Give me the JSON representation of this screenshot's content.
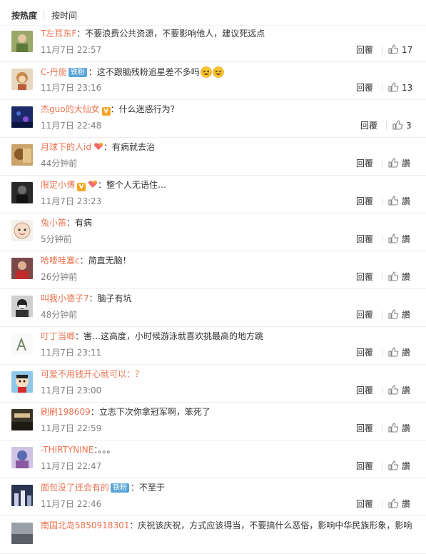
{
  "sort": {
    "hot": "按热度",
    "time": "按时间"
  },
  "reply_label": "回覆",
  "like_label": "讚",
  "colors": {
    "username": "#eb7350",
    "fans_badge": "#5aa5d8",
    "vip_badge": "#f5a623"
  },
  "comments": [
    {
      "user": "T左耳东F",
      "text": "不要浪费公共资源，不要影响他人，建议死远点",
      "time": "11月7日 22:57",
      "likes": "17",
      "avatar": "person-green"
    },
    {
      "user": "C-丹旎",
      "fans_badge": "铁粉",
      "text": "这不跟脑残粉追星差不多吗",
      "emoji": "laughing-emoji",
      "time": "11月7日 23:16",
      "likes": "13",
      "avatar": "doll"
    },
    {
      "user": "杰guo的大仙女",
      "vip": "V",
      "text": "什么迷惑行为？",
      "time": "11月7日 22:48",
      "likes": "3",
      "avatar": "night-blue"
    },
    {
      "user": "月球下的人id",
      "heart": true,
      "text": "有病就去治",
      "time": "44分钟前",
      "likes": "",
      "avatar": "warm-brown"
    },
    {
      "user": "限定小博",
      "vip": "V",
      "heart": true,
      "text": "整个人无语住…",
      "time": "11月7日 23:23",
      "likes": "",
      "avatar": "dark-figure"
    },
    {
      "user": "兔小笛",
      "text": "有病",
      "time": "5分钟前",
      "likes": "",
      "avatar": "cartoon-face"
    },
    {
      "user": "哈喽哇塞c",
      "text": "简直无脑！",
      "time": "26分钟前",
      "likes": "",
      "avatar": "red-person"
    },
    {
      "user": "叫我小德子7",
      "text": "脑子有坑",
      "time": "48分钟前",
      "likes": "",
      "avatar": "mask-person"
    },
    {
      "user": "叮丁当啷",
      "text": "害…这高度，小时候游泳就喜欢挑最高的地方跳",
      "time": "11月7日 23:11",
      "likes": "",
      "avatar": "sketch"
    },
    {
      "user": "可爱不用钱开心就可以：？",
      "text": "",
      "time": "11月7日 23:00",
      "likes": "",
      "avatar": "crayon-kid"
    },
    {
      "user": "刷刷198609",
      "text": "立志下次你拿冠军啊，笨死了",
      "time": "11月7日 22:59",
      "likes": "",
      "avatar": "dark-scene"
    },
    {
      "user": "-THIRTYNINE",
      "text": "。。。",
      "time": "11月7日 22:47",
      "likes": "",
      "avatar": "blue-portrait"
    },
    {
      "user": "面包没了还会有的",
      "fans_badge": "铁粉",
      "text": "不至于",
      "time": "11月7日 22:46",
      "likes": "",
      "avatar": "night-city"
    },
    {
      "user": "南国北岛5850918301",
      "text": "庆祝该庆祝，方式应该得当，不要搞什么恶俗，影响中华民族形象，影响",
      "time": "",
      "likes": "",
      "avatar": "gray-landscape"
    }
  ]
}
